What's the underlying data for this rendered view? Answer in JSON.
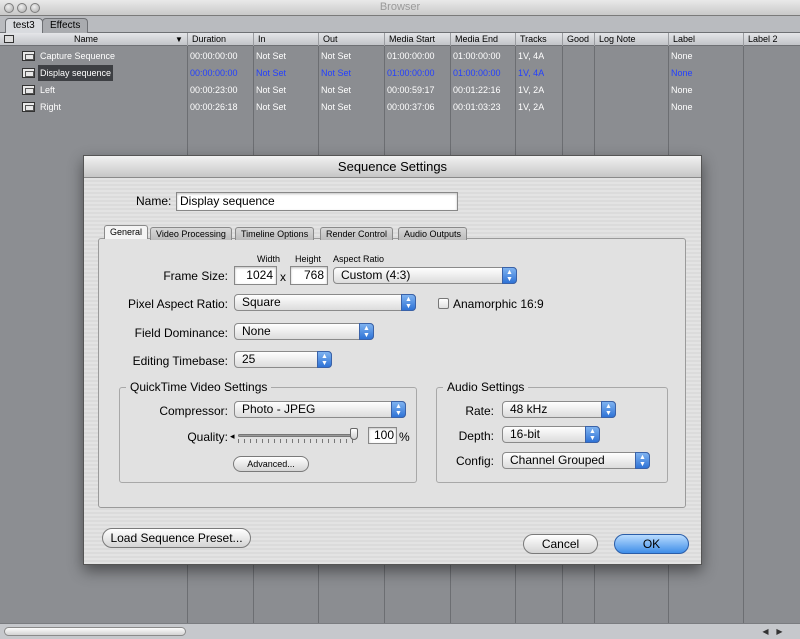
{
  "window": {
    "title": "Browser"
  },
  "browser_tabs": [
    {
      "label": "test3"
    },
    {
      "label": "Effects"
    }
  ],
  "columns": {
    "name": "Name",
    "duration": "Duration",
    "in": "In",
    "out": "Out",
    "media_start": "Media Start",
    "media_end": "Media End",
    "tracks": "Tracks",
    "good": "Good",
    "log_note": "Log Note",
    "label": "Label",
    "label2": "Label 2"
  },
  "rows": [
    {
      "name": "Capture Sequence",
      "duration": "00:00:00:00",
      "in": "Not Set",
      "out": "Not Set",
      "media_start": "01:00:00:00",
      "media_end": "01:00:00:00",
      "tracks": "1V, 4A",
      "label": "None"
    },
    {
      "name": "Display sequence",
      "duration": "00:00:00:00",
      "in": "Not Set",
      "out": "Not Set",
      "media_start": "01:00:00:00",
      "media_end": "01:00:00:00",
      "tracks": "1V, 4A",
      "label": "None",
      "selected": true
    },
    {
      "name": "Left",
      "duration": "00:00:23:00",
      "in": "Not Set",
      "out": "Not Set",
      "media_start": "00:00:59:17",
      "media_end": "00:01:22:16",
      "tracks": "1V, 2A",
      "label": "None"
    },
    {
      "name": "Right",
      "duration": "00:00:26:18",
      "in": "Not Set",
      "out": "Not Set",
      "media_start": "00:00:37:06",
      "media_end": "00:01:03:23",
      "tracks": "1V, 2A",
      "label": "None"
    }
  ],
  "dialog": {
    "title": "Sequence Settings",
    "name_label": "Name:",
    "name_value": "Display sequence",
    "tabs": [
      {
        "label": "General"
      },
      {
        "label": "Video Processing"
      },
      {
        "label": "Timeline Options"
      },
      {
        "label": "Render Control"
      },
      {
        "label": "Audio Outputs"
      }
    ],
    "frame_size": {
      "label": "Frame Size:",
      "width_caption": "Width",
      "height_caption": "Height",
      "aspect_caption": "Aspect Ratio",
      "width": "1024",
      "times": "x",
      "height": "768",
      "aspect_ratio": "Custom (4:3)"
    },
    "pixel_aspect": {
      "label": "Pixel Aspect Ratio:",
      "value": "Square"
    },
    "anamorphic": {
      "label": "Anamorphic 16:9",
      "checked": false
    },
    "field_dominance": {
      "label": "Field Dominance:",
      "value": "None"
    },
    "editing_timebase": {
      "label": "Editing Timebase:",
      "value": "25"
    },
    "quicktime": {
      "title": "QuickTime Video Settings",
      "compressor_label": "Compressor:",
      "compressor": "Photo - JPEG",
      "quality_label": "Quality:",
      "quality_value": "100",
      "quality_unit": "%",
      "quality_fraction": 1.0,
      "advanced_button": "Advanced..."
    },
    "audio": {
      "title": "Audio Settings",
      "rate_label": "Rate:",
      "rate": "48 kHz",
      "depth_label": "Depth:",
      "depth": "16-bit",
      "config_label": "Config:",
      "config": "Channel Grouped"
    },
    "load_preset_button": "Load Sequence Preset...",
    "cancel_button": "Cancel",
    "ok_button": "OK"
  }
}
